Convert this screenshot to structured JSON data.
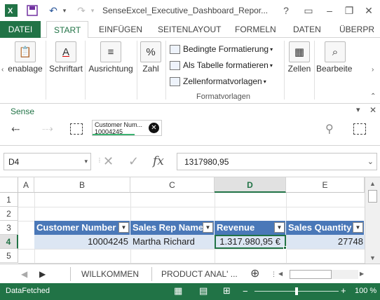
{
  "titlebar": {
    "title": "SenseExcel_Executive_Dashboard_Repor...",
    "help": "?",
    "minimize": "–",
    "restore": "❐",
    "close": "✕"
  },
  "tabs": [
    "DATEI",
    "START",
    "EINFÜGEN",
    "SEITENLAYOUT",
    "FORMELN",
    "DATEN",
    "ÜBERPR"
  ],
  "ribbon": {
    "clipboard": "enablage",
    "font": "Schriftart",
    "alignment": "Ausrichtung",
    "number": "Zahl",
    "cond_format": "Bedingte Formatierung",
    "as_table": "Als Tabelle formatieren",
    "cell_styles": "Zellenformatvorlagen",
    "styles_group": "Formatvorlagen",
    "cells": "Zellen",
    "editing": "Bearbeite"
  },
  "sense": {
    "title": "Sense",
    "chip_label": "Customer Num...",
    "chip_value": "10004245"
  },
  "formula_bar": {
    "name_box": "D4",
    "fx": "fx",
    "value": "1317980,95"
  },
  "grid": {
    "columns": [
      "A",
      "B",
      "C",
      "D",
      "E"
    ],
    "rows": [
      "1",
      "2",
      "3",
      "4",
      "5"
    ],
    "headers": [
      "Customer Number",
      "Sales Rep Name",
      "Revenue",
      "Sales Quantity"
    ],
    "row4": [
      "10004245",
      "Martha Richard",
      "1.317.980,95 €",
      "27748"
    ]
  },
  "sheets": {
    "tab1": "WILLKOMMEN",
    "tab2": "PRODUCT ANAL' ...",
    "add": "⊕"
  },
  "status": {
    "text": "DataFetched",
    "zoom": "100 %"
  }
}
